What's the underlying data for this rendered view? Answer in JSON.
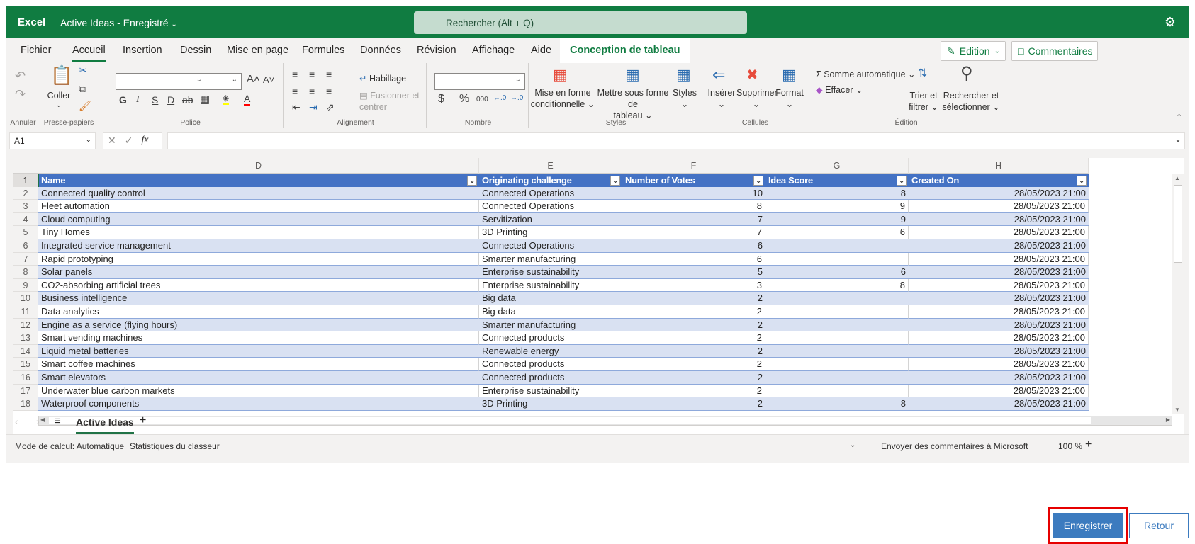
{
  "titlebar": {
    "app_name": "Excel",
    "doc_title": "Active Ideas",
    "separator": "-",
    "save_state": "Enregistré",
    "search_placeholder": "Rechercher (Alt + Q)",
    "settings_icon": "gear-icon"
  },
  "ribbon_tabs": [
    {
      "label": "Fichier"
    },
    {
      "label": "Accueil",
      "active": true
    },
    {
      "label": "Insertion"
    },
    {
      "label": "Dessin"
    },
    {
      "label": "Mise en page"
    },
    {
      "label": "Formules"
    },
    {
      "label": "Données"
    },
    {
      "label": "Révision"
    },
    {
      "label": "Affichage"
    },
    {
      "label": "Aide"
    },
    {
      "label": "Conception de tableau",
      "contextual": true
    }
  ],
  "top_right": {
    "edit_label": "Edition",
    "comments_label": "Commentaires"
  },
  "ribbon": {
    "groups": {
      "undo": "Annuler",
      "clipboard": "Presse-papiers",
      "font": "Police",
      "alignment": "Alignement",
      "number": "Nombre",
      "styles": "Styles",
      "cells": "Cellules",
      "editing": "Édition"
    },
    "paste": "Coller",
    "bold": "G",
    "italic": "I",
    "underline": "S",
    "double_underline": "D",
    "strike": "ab",
    "wrap": "Habillage",
    "merge": "Fusionner et centrer",
    "currency": "$",
    "percent": "%",
    "thousands": "000",
    "cond_format_1": "Mise en forme",
    "cond_format_2": "conditionnelle",
    "as_table_1": "Mettre sous forme de",
    "as_table_2": "tableau",
    "styles": "Styles",
    "insert": "Insérer",
    "delete": "Supprimer",
    "format": "Format",
    "autosum": "Somme automatique",
    "clear": "Effacer",
    "sort_1": "Trier et",
    "sort_2": "filtrer",
    "find_1": "Rechercher et",
    "find_2": "sélectionner",
    "font_color": "#ff0000",
    "highlight_color": "#ffff00"
  },
  "formula_bar": {
    "name_box": "A1",
    "fx": "fx",
    "value": ""
  },
  "sheet": {
    "columns": [
      "D",
      "E",
      "F",
      "G",
      "H"
    ],
    "headers": [
      "Name",
      "Originating challenge",
      "Number of Votes",
      "Idea Score",
      "Created On"
    ],
    "rows": [
      {
        "n": "2",
        "name": "Connected quality control",
        "challenge": "Connected Operations",
        "votes": "10",
        "score": "8",
        "created": "28/05/2023 21:00"
      },
      {
        "n": "3",
        "name": "Fleet automation",
        "challenge": "Connected Operations",
        "votes": "8",
        "score": "9",
        "created": "28/05/2023 21:00"
      },
      {
        "n": "4",
        "name": "Cloud computing",
        "challenge": "Servitization",
        "votes": "7",
        "score": "9",
        "created": "28/05/2023 21:00"
      },
      {
        "n": "5",
        "name": "Tiny Homes",
        "challenge": "3D Printing",
        "votes": "7",
        "score": "6",
        "created": "28/05/2023 21:00"
      },
      {
        "n": "6",
        "name": "Integrated service management",
        "challenge": "Connected Operations",
        "votes": "6",
        "score": "",
        "created": "28/05/2023 21:00"
      },
      {
        "n": "7",
        "name": "Rapid prototyping",
        "challenge": "Smarter manufacturing",
        "votes": "6",
        "score": "",
        "created": "28/05/2023 21:00"
      },
      {
        "n": "8",
        "name": "Solar panels",
        "challenge": "Enterprise sustainability",
        "votes": "5",
        "score": "6",
        "created": "28/05/2023 21:00"
      },
      {
        "n": "9",
        "name": "CO2-absorbing artificial trees",
        "challenge": "Enterprise sustainability",
        "votes": "3",
        "score": "8",
        "created": "28/05/2023 21:00"
      },
      {
        "n": "10",
        "name": "Business intelligence",
        "challenge": "Big data",
        "votes": "2",
        "score": "",
        "created": "28/05/2023 21:00"
      },
      {
        "n": "11",
        "name": "Data analytics",
        "challenge": "Big data",
        "votes": "2",
        "score": "",
        "created": "28/05/2023 21:00"
      },
      {
        "n": "12",
        "name": "Engine as a service (flying hours)",
        "challenge": "Smarter manufacturing",
        "votes": "2",
        "score": "",
        "created": "28/05/2023 21:00"
      },
      {
        "n": "13",
        "name": "Smart vending machines",
        "challenge": "Connected products",
        "votes": "2",
        "score": "",
        "created": "28/05/2023 21:00"
      },
      {
        "n": "14",
        "name": "Liquid metal batteries",
        "challenge": "Renewable energy",
        "votes": "2",
        "score": "",
        "created": "28/05/2023 21:00"
      },
      {
        "n": "15",
        "name": "Smart coffee machines",
        "challenge": "Connected products",
        "votes": "2",
        "score": "",
        "created": "28/05/2023 21:00"
      },
      {
        "n": "16",
        "name": "Smart elevators",
        "challenge": "Connected products",
        "votes": "2",
        "score": "",
        "created": "28/05/2023 21:00"
      },
      {
        "n": "17",
        "name": "Underwater blue carbon markets",
        "challenge": "Enterprise sustainability",
        "votes": "2",
        "score": "",
        "created": "28/05/2023 21:00"
      },
      {
        "n": "18",
        "name": "Waterproof components",
        "challenge": "3D Printing",
        "votes": "2",
        "score": "8",
        "created": "28/05/2023 21:00"
      }
    ],
    "header_row_number": "1",
    "header_color": "#4472c4",
    "band_color": "#d9e1f2"
  },
  "sheet_tabs": {
    "active": "Active Ideas",
    "add": "+"
  },
  "status_bar": {
    "calc_mode": "Mode de calcul: Automatique",
    "stats": "Statistiques du classeur",
    "feedback": "Envoyer des commentaires à Microsoft",
    "zoom": "100 %",
    "zoom_out": "—",
    "zoom_in": "+"
  },
  "footer": {
    "save_label": "Enregistrer",
    "back_label": "Retour"
  }
}
